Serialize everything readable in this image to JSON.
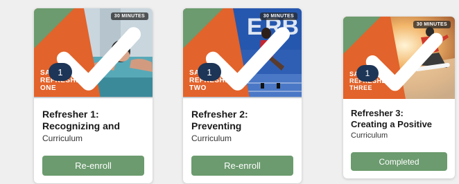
{
  "cards": [
    {
      "duration": "30 MINUTES",
      "badge": "1",
      "series_prefix": "SA",
      "series_name": "REFRESHER",
      "series_num": "ONE",
      "title_line1": "Refresher 1:",
      "title_line2": "Recognizing and",
      "subtitle": "Curriculum",
      "button": "Re-enroll"
    },
    {
      "duration": "30 MINUTES",
      "badge": "1",
      "series_prefix": "SA",
      "series_name": "REFRESHER",
      "series_num": "TWO",
      "title_line1": "Refresher 2:",
      "title_line2": "Preventing",
      "subtitle": "Curriculum",
      "button": "Re-enroll"
    },
    {
      "duration": "30 MINUTES",
      "badge": "1",
      "series_prefix": "SA",
      "series_name": "REFRESHER",
      "series_num": "THREE",
      "title_line1": "Refresher 3:",
      "title_line2": "Creating a Positive",
      "subtitle": "Curriculum",
      "button": "Completed"
    }
  ],
  "colors": {
    "orange": "#e2632b",
    "green_corner": "#6b9b6e",
    "badge": "#1d3557",
    "button": "#6b9b6e"
  },
  "icons": [
    "checkmark-icon"
  ]
}
